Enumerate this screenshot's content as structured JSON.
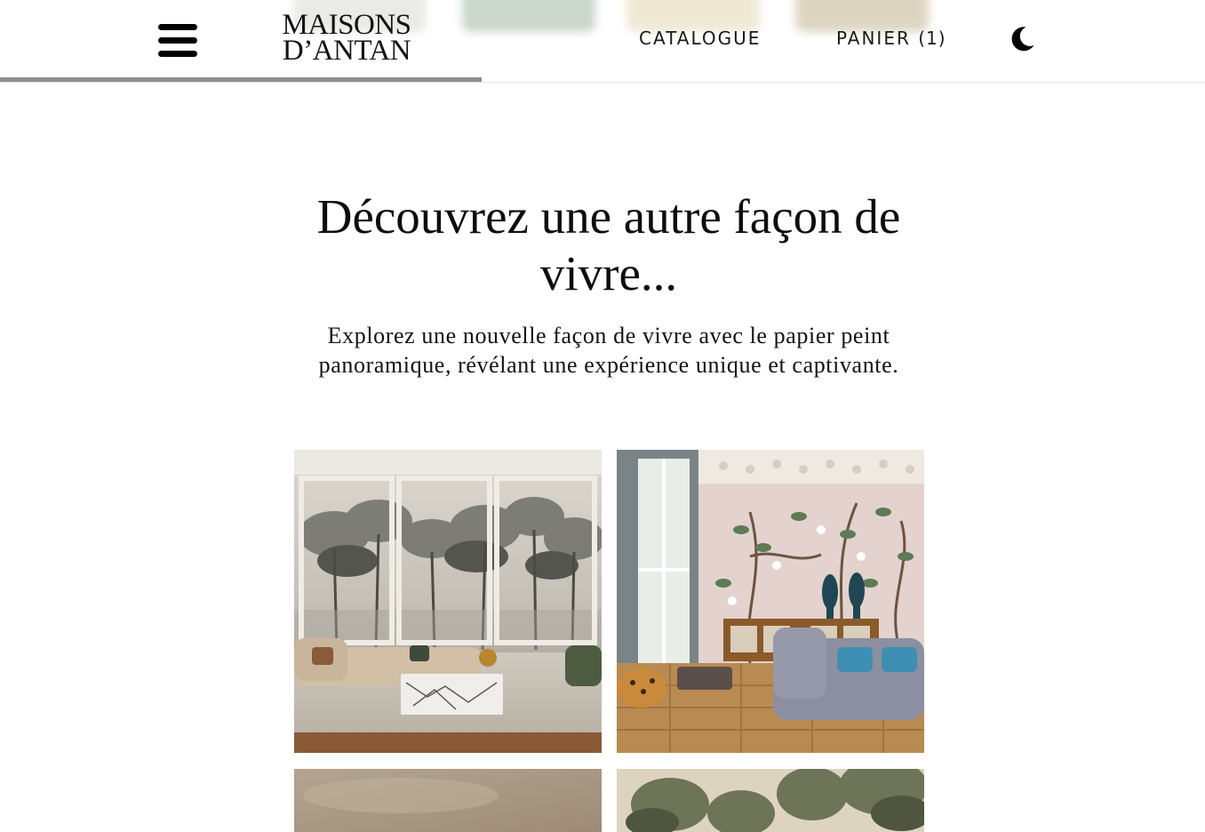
{
  "brand": {
    "logo_line1": "MAISONS",
    "logo_line2": "D’ANTAN"
  },
  "header": {
    "nav": {
      "catalogue_label": "CATALOGUE",
      "cart_label": "PANIER",
      "cart_count": "(1)"
    },
    "icons": {
      "menu": "hamburger-menu-icon",
      "theme": "moon-icon"
    },
    "scroll_progress": 0.4
  },
  "hero": {
    "title": "Découvrez une autre façon de vivre...",
    "subtitle": "Explorez une nouvelle façon de vivre avec le papier peint panoramique, révélant une expérience unique et captivante."
  },
  "gallery": {
    "images": [
      {
        "subject": "living-room-misty-forest-mural"
      },
      {
        "subject": "living-room-peacock-chinoiserie-mural"
      },
      {
        "subject": "taupe-textured-wall"
      },
      {
        "subject": "landscape-trees-mural"
      }
    ]
  },
  "colors": {
    "text": "#111111",
    "background": "#ffffff",
    "progress": "#8d8d8d",
    "border": "#e4e4e4"
  }
}
